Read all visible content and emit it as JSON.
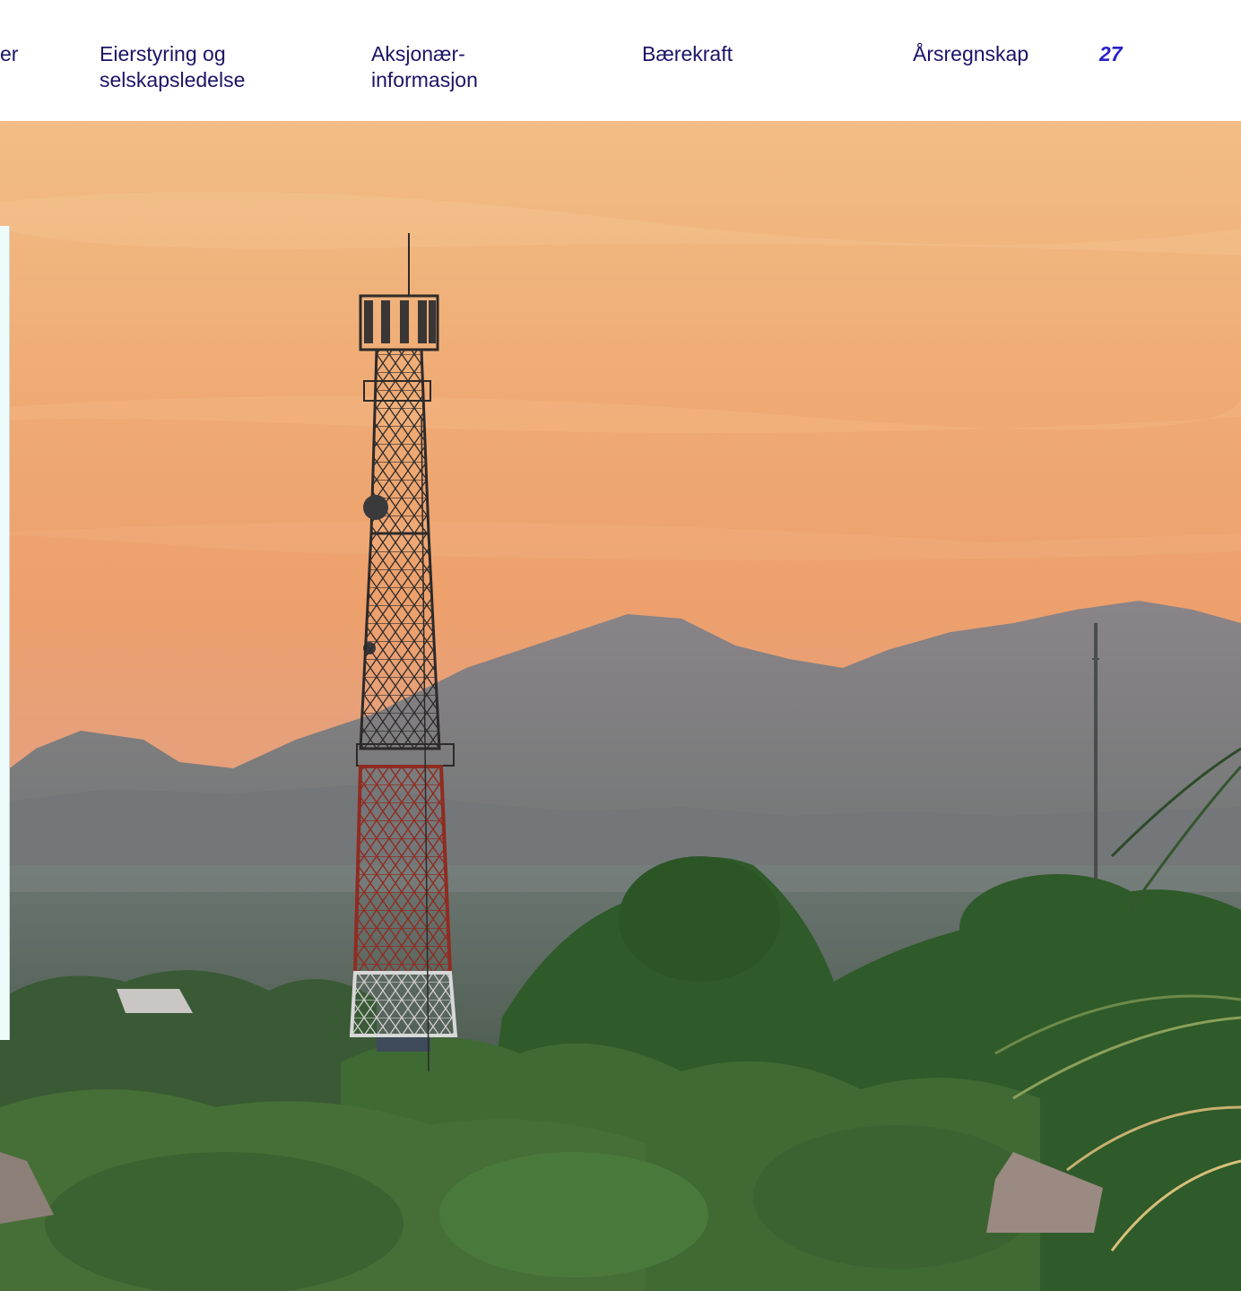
{
  "nav": {
    "items": [
      {
        "line1": "er",
        "line2": ""
      },
      {
        "line1": "Eierstyring og",
        "line2": "selskapsledelse"
      },
      {
        "line1": "Aksjonær-",
        "line2": "informasjon"
      },
      {
        "line1": "Bærekraft",
        "line2": ""
      },
      {
        "line1": "Årsregnskap",
        "line2": ""
      }
    ],
    "page_number": "27"
  },
  "colors": {
    "nav_text": "#1a1466",
    "page_number": "#2a22c8",
    "sky_top": "#f3b57c",
    "sky_bottom": "#efa06a",
    "mountains": "#7b7a7d",
    "foliage": "#2f5a2a",
    "tower_red": "#8f2c22"
  }
}
